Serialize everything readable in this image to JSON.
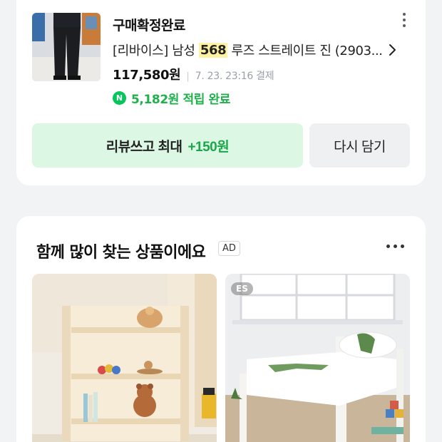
{
  "order": {
    "status": "구매확정완료",
    "product_name_prefix": "[리바이스] 남성 ",
    "product_name_highlight": "568",
    "product_name_suffix": " 루즈 스트레이트 진 (2903...",
    "price": "117,580원",
    "paid_at": "7. 23. 23:16 결제",
    "point_badge": "N",
    "points": "5,182원 적립 완료",
    "review_button_prefix": "리뷰쓰고 최대",
    "review_button_bonus": "+150원",
    "recart_button": "다시 담기",
    "icons": [
      "product-thumbnail",
      "more-vertical-icon",
      "chevron-right-icon",
      "naver-point-icon"
    ]
  },
  "recommendations": {
    "title": "함께 많이 찾는 상품이에요",
    "ad_label": "AD",
    "items": [
      {
        "image": "wooden-bookshelf-with-toys"
      },
      {
        "badge": "ES",
        "image": "white-kids-bed-dinosaur"
      }
    ]
  },
  "colors": {
    "accent_green": "#1fb24c",
    "naver_green": "#03c75a",
    "review_button_bg": "#dcf8e4",
    "highlight_yellow": "#fff3a3"
  }
}
